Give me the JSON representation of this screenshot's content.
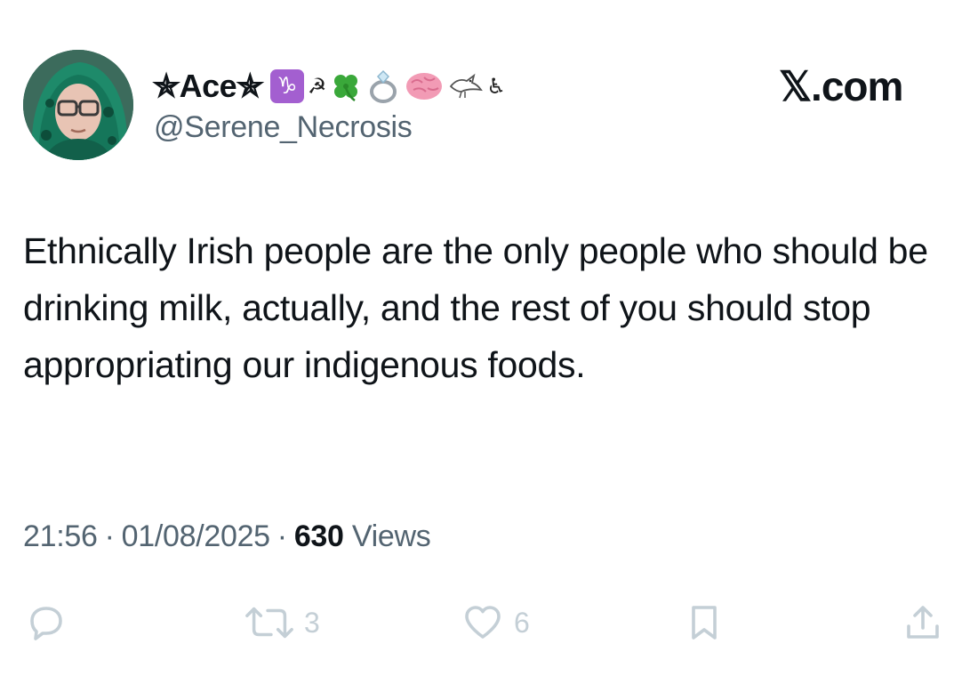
{
  "author": {
    "display_name": "✯Ace✯",
    "name_emojis": [
      "capricorn-icon",
      "hammer-sickle-icon",
      "four-leaf-clover-icon",
      "ring-icon",
      "brain-icon",
      "bird-icon",
      "wheelchair-icon"
    ],
    "capricorn_glyph": "♑",
    "hammer_sickle_glyph": "☭",
    "wheelchair_glyph": "♿",
    "handle": "@Serene_Necrosis"
  },
  "brand": "𝕏.com",
  "tweet": {
    "text": "Ethnically Irish people are the only people who should be drinking milk, actually, and the rest of you should stop appropriating our indigenous foods."
  },
  "meta": {
    "time": "21:56",
    "separator": "·",
    "date": "01/08/2025",
    "views_count": "630",
    "views_label": "Views"
  },
  "actions": {
    "reply_count": "",
    "retweet_count": "3",
    "like_count": "6"
  },
  "colors": {
    "text_primary": "#0f1419",
    "text_secondary": "#536471",
    "action_icons": "#c4cfd6",
    "capricorn_badge": "#a35fd0"
  }
}
